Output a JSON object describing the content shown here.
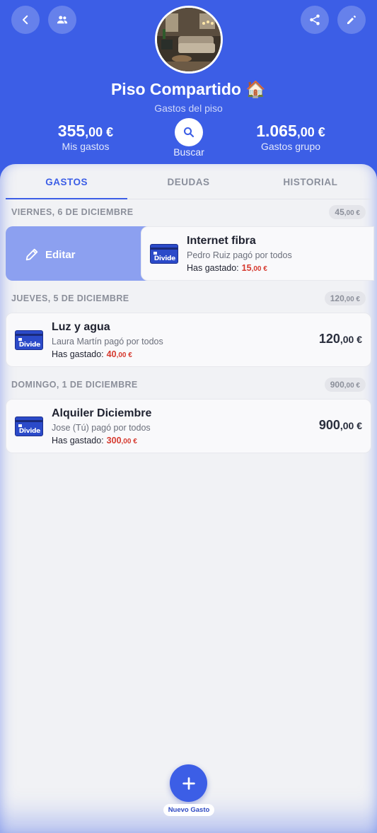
{
  "header": {
    "title": "Piso Compartido 🏠",
    "subtitle": "Gastos del piso",
    "my_expenses": {
      "int": "355",
      "dec": ",00 €",
      "label": "Mis gastos"
    },
    "group_expenses": {
      "int": "1.065",
      "dec": ",00 €",
      "label": "Gastos grupo"
    },
    "search_label": "Buscar"
  },
  "tabs": [
    {
      "label": "GASTOS",
      "active": true
    },
    {
      "label": "DEUDAS",
      "active": false
    },
    {
      "label": "HISTORIAL",
      "active": false
    }
  ],
  "days": [
    {
      "date": "VIERNES, 6 DE DICIEMBRE",
      "total_int": "45",
      "total_dec": ",00 €",
      "expense": {
        "title": "Internet fibra",
        "payer": "Pedro Ruiz pagó por todos",
        "spent_label": "Has gastado:",
        "spent_int": "15",
        "spent_dec": ",00 €",
        "edit_label": "Editar"
      }
    },
    {
      "date": "JUEVES, 5 DE DICIEMBRE",
      "total_int": "120",
      "total_dec": ",00 €",
      "expense": {
        "title": "Luz y agua",
        "payer": "Laura Martín pagó por todos",
        "spent_label": "Has gastado:",
        "spent_int": "40",
        "spent_dec": ",00 €",
        "amount_int": "120",
        "amount_dec": ",00 €"
      }
    },
    {
      "date": "DOMINGO, 1 DE DICIEMBRE",
      "total_int": "900",
      "total_dec": ",00 €",
      "expense": {
        "title": "Alquiler Diciembre",
        "payer": "Jose (Tú) pagó por todos",
        "spent_label": "Has gastado:",
        "spent_int": "300",
        "spent_dec": ",00 €",
        "amount_int": "900",
        "amount_dec": ",00 €"
      }
    }
  ],
  "card_brand": "Divide",
  "fab_label": "Nuevo Gasto",
  "colors": {
    "primary": "#3c5ee6",
    "negative": "#d63a2f",
    "background": "#f1f2f5"
  }
}
